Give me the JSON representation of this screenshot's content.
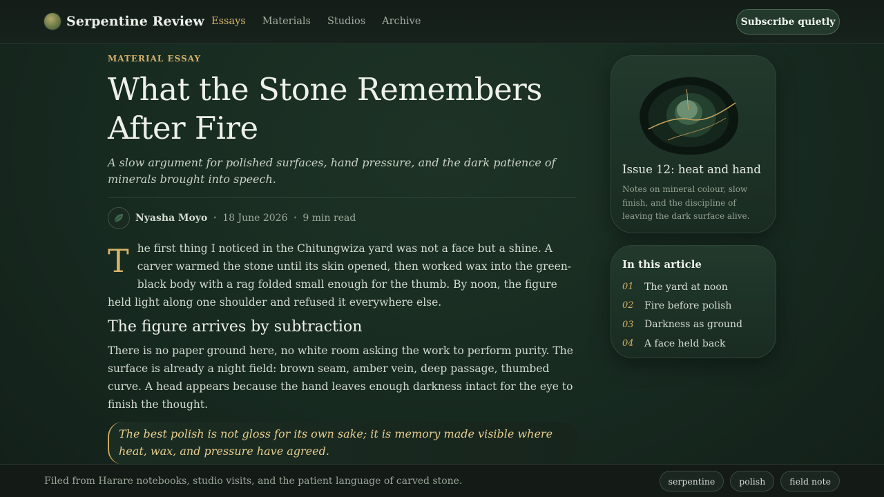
{
  "header": {
    "brand": "Serpentine Review",
    "nav": [
      "Essays",
      "Materials",
      "Studios",
      "Archive"
    ],
    "nav_active": "Essays",
    "subscribe": "Subscribe quietly"
  },
  "article": {
    "kicker": "MATERIAL ESSAY",
    "title": "What the Stone Remembers After Fire",
    "dek": "A slow argument for polished surfaces, hand pressure, and the dark patience of minerals brought into speech.",
    "author": "Nyasha Moyo",
    "date": "18 June 2026",
    "read_time": "9 min read",
    "dropcap": "T",
    "lede": "he first thing I noticed in the Chitungwiza yard was not a face but a shine. A carver warmed the stone until its skin opened, then worked wax into the green-black body with a rag folded small enough for the thumb. By noon, the figure held light along one shoulder and refused it everywhere else.",
    "section_heading": "The figure arrives by subtraction",
    "paragraph": "There is no paper ground here, no white room asking the work to perform purity. The surface is already a night field: brown seam, amber vein, deep passage, thumbed curve. A head appears because the hand leaves enough darkness intact for the eye to finish the thought.",
    "pullquote": "The best polish is not gloss for its own sake; it is memory made visible where heat, wax, and pressure have agreed."
  },
  "sidebar": {
    "issue_title": "Issue 12: heat and hand",
    "issue_text": "Notes on mineral colour, slow finish, and the discipline of leaving the dark surface alive.",
    "toc_title": "In this article",
    "toc": [
      {
        "num": "01",
        "label": "The yard at noon"
      },
      {
        "num": "02",
        "label": "Fire before polish"
      },
      {
        "num": "03",
        "label": "Darkness as ground"
      },
      {
        "num": "04",
        "label": "A face held back"
      }
    ]
  },
  "footer": {
    "note": "Filed from Harare notebooks, studio visits, and the patient language of carved stone.",
    "tags": [
      "serpentine",
      "polish",
      "field note"
    ]
  },
  "colors": {
    "accent_gold": "#d1ad62",
    "background": "#172a20"
  }
}
